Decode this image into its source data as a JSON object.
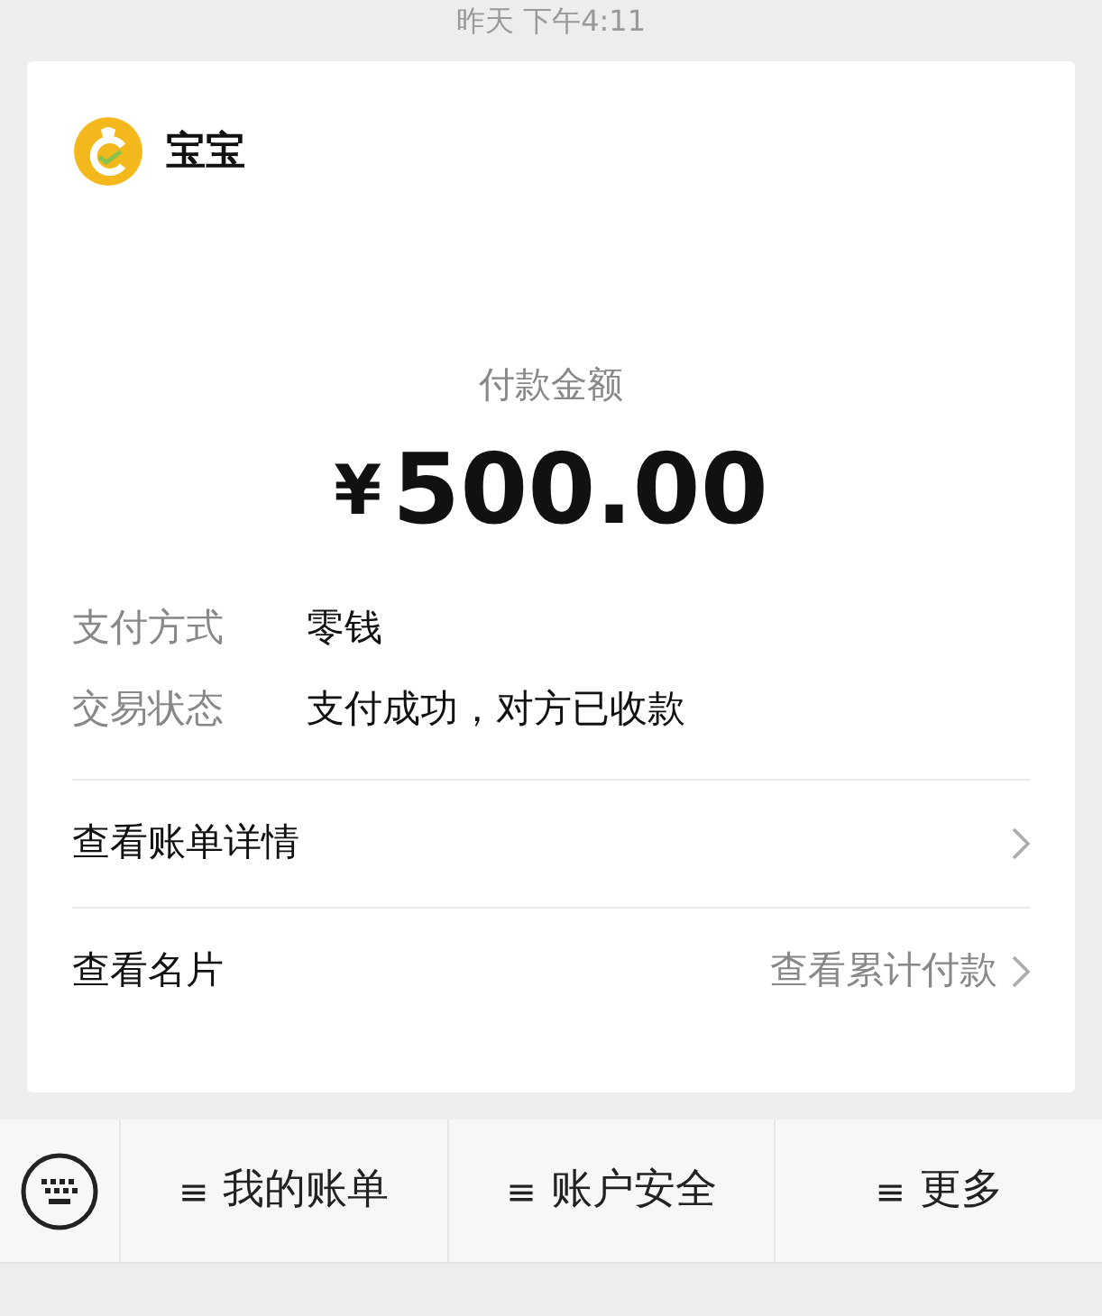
{
  "timestamp": "昨天 下午4:11",
  "card": {
    "payee": "宝宝",
    "amount_label": "付款金额",
    "currency": "¥",
    "amount": "500.00",
    "details": [
      {
        "label": "支付方式",
        "value": "零钱"
      },
      {
        "label": "交易状态",
        "value": "支付成功，对方已收款"
      }
    ],
    "links": [
      {
        "label": "查看账单详情"
      },
      {
        "label": "查看名片",
        "extra": "查看累计付款"
      }
    ]
  },
  "menu": [
    {
      "icon": "≡",
      "label": "我的账单"
    },
    {
      "icon": "≡",
      "label": "账户安全"
    },
    {
      "icon": "≡",
      "label": "更多"
    }
  ]
}
